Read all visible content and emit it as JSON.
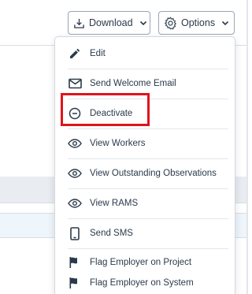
{
  "toolbar": {
    "download_label": "Download",
    "options_label": "Options"
  },
  "menu": {
    "items": [
      {
        "label": "Edit",
        "icon": "pencil-icon"
      },
      {
        "label": "Send Welcome Email",
        "icon": "envelope-icon"
      },
      {
        "label": "Deactivate",
        "icon": "minus-circle-icon"
      },
      {
        "label": "View Workers",
        "icon": "eye-icon"
      },
      {
        "label": "View Outstanding Observations",
        "icon": "eye-icon"
      },
      {
        "label": "View RAMS",
        "icon": "eye-icon"
      },
      {
        "label": "Send SMS",
        "icon": "phone-icon"
      },
      {
        "label": "Flag Employer on Project",
        "icon": "flag-icon"
      },
      {
        "label": "Flag Employer on System",
        "icon": "flag-icon"
      }
    ]
  },
  "colors": {
    "highlight": "#e0141b",
    "text": "#2b3a4a"
  }
}
